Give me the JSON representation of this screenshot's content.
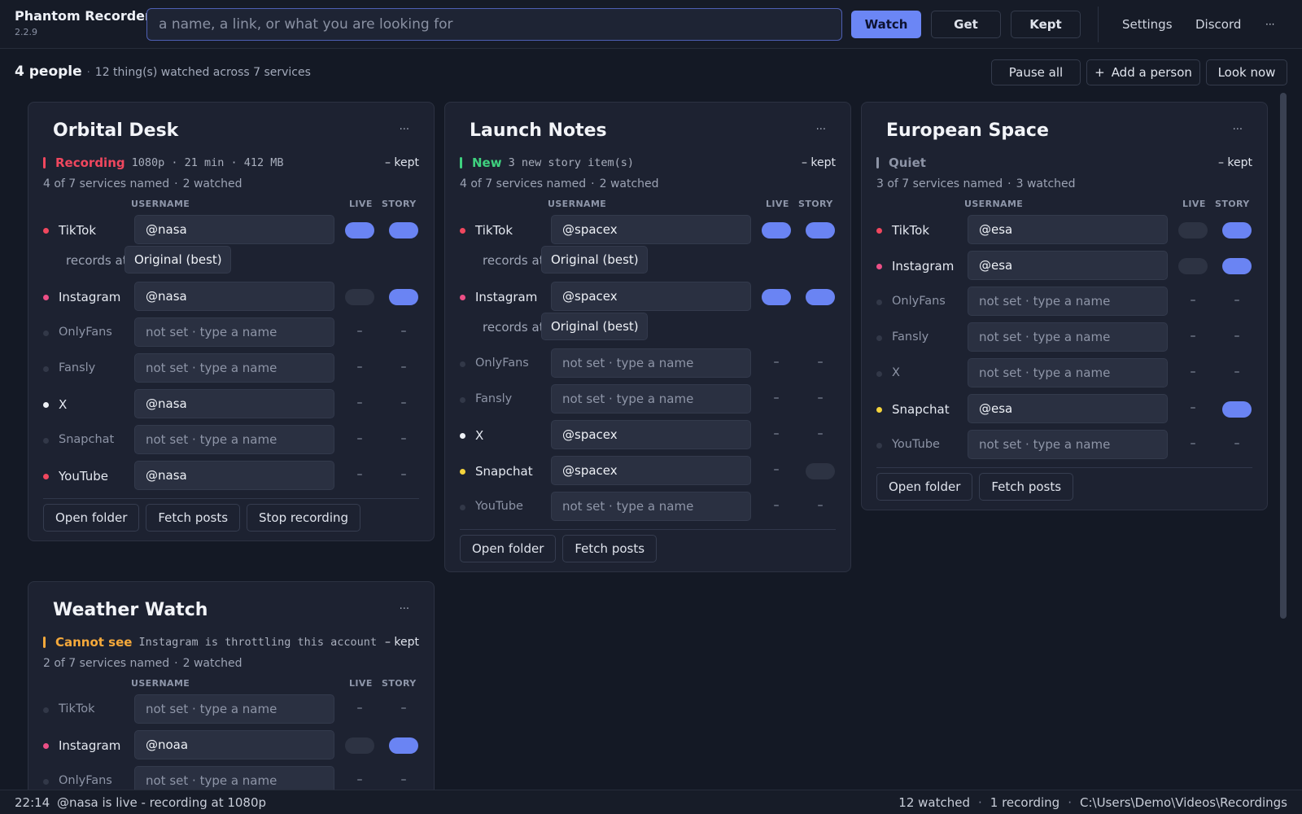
{
  "app": {
    "name": "Phantom Recorder",
    "version": "2.2.9"
  },
  "search": {
    "placeholder": "a name, a link, or what you are looking for"
  },
  "topbar": {
    "watch": "Watch",
    "get": "Get",
    "kept": "Kept",
    "settings": "Settings",
    "discord": "Discord",
    "more": "···"
  },
  "summary": {
    "people": "4 people",
    "detail": "12 thing(s) watched across 7 services"
  },
  "actions": {
    "pause_all": "Pause all",
    "add_person": "Add a person",
    "add_icon": "+",
    "look_now": "Look now"
  },
  "labels": {
    "username": "USERNAME",
    "live": "LIVE",
    "story": "STORY",
    "records_at": "records at",
    "kept": "– kept",
    "dash": "–",
    "menu": "···"
  },
  "colors": {
    "accent": "#6a84f3",
    "recording": "#f0475e",
    "new": "#3fd17f",
    "quiet": "#8c93a5",
    "cannot_see": "#f5a93b",
    "tiktok": "#f0475e",
    "instagram": "#ec4f86",
    "x": "#eef1f6",
    "snapchat": "#f4d33c",
    "youtube": "#f0475e",
    "unset": "#323848"
  },
  "cards": [
    {
      "title": "Orbital Desk",
      "status": {
        "label": "Recording",
        "detail": "1080p · 21 min · 412 MB",
        "color": "#f0475e"
      },
      "named": "4 of 7 services named",
      "watched": "2 watched",
      "services": [
        {
          "name": "TikTok",
          "set": true,
          "color": "#f0475e",
          "username": "@nasa",
          "live": "on",
          "story": "on",
          "records_at": "Original (best)"
        },
        {
          "name": "Instagram",
          "set": true,
          "color": "#ec4f86",
          "username": "@nasa",
          "live": "off",
          "story": "on"
        },
        {
          "name": "OnlyFans",
          "set": false,
          "username": "not set  ·  type a name",
          "live": "none",
          "story": "none"
        },
        {
          "name": "Fansly",
          "set": false,
          "username": "not set  ·  type a name",
          "live": "none",
          "story": "none"
        },
        {
          "name": "X",
          "set": true,
          "color": "#eef1f6",
          "username": "@nasa",
          "live": "none",
          "story": "none"
        },
        {
          "name": "Snapchat",
          "set": false,
          "username": "not set  ·  type a name",
          "live": "none",
          "story": "none"
        },
        {
          "name": "YouTube",
          "set": true,
          "color": "#f0475e",
          "username": "@nasa",
          "live": "none",
          "story": "none"
        }
      ],
      "buttons": [
        "Open folder",
        "Fetch posts",
        "Stop recording"
      ]
    },
    {
      "title": "Launch Notes",
      "status": {
        "label": "New",
        "detail": "3 new story item(s)",
        "color": "#3fd17f"
      },
      "named": "4 of 7 services named",
      "watched": "2 watched",
      "services": [
        {
          "name": "TikTok",
          "set": true,
          "color": "#f0475e",
          "username": "@spacex",
          "live": "on",
          "story": "on",
          "records_at": "Original (best)"
        },
        {
          "name": "Instagram",
          "set": true,
          "color": "#ec4f86",
          "username": "@spacex",
          "live": "on",
          "story": "on",
          "records_at": "Original (best)"
        },
        {
          "name": "OnlyFans",
          "set": false,
          "username": "not set  ·  type a name",
          "live": "none",
          "story": "none"
        },
        {
          "name": "Fansly",
          "set": false,
          "username": "not set  ·  type a name",
          "live": "none",
          "story": "none"
        },
        {
          "name": "X",
          "set": true,
          "color": "#eef1f6",
          "username": "@spacex",
          "live": "none",
          "story": "none"
        },
        {
          "name": "Snapchat",
          "set": true,
          "color": "#f4d33c",
          "username": "@spacex",
          "live": "none",
          "story": "off"
        },
        {
          "name": "YouTube",
          "set": false,
          "username": "not set  ·  type a name",
          "live": "none",
          "story": "none"
        }
      ],
      "buttons": [
        "Open folder",
        "Fetch posts"
      ]
    },
    {
      "title": "European Space",
      "status": {
        "label": "Quiet",
        "detail": "",
        "color": "#8c93a5"
      },
      "named": "3 of 7 services named",
      "watched": "3 watched",
      "services": [
        {
          "name": "TikTok",
          "set": true,
          "color": "#f0475e",
          "username": "@esa",
          "live": "off",
          "story": "on"
        },
        {
          "name": "Instagram",
          "set": true,
          "color": "#ec4f86",
          "username": "@esa",
          "live": "off",
          "story": "on"
        },
        {
          "name": "OnlyFans",
          "set": false,
          "username": "not set  ·  type a name",
          "live": "none",
          "story": "none"
        },
        {
          "name": "Fansly",
          "set": false,
          "username": "not set  ·  type a name",
          "live": "none",
          "story": "none"
        },
        {
          "name": "X",
          "set": false,
          "username": "not set  ·  type a name",
          "live": "none",
          "story": "none"
        },
        {
          "name": "Snapchat",
          "set": true,
          "color": "#f4d33c",
          "username": "@esa",
          "live": "none",
          "story": "on"
        },
        {
          "name": "YouTube",
          "set": false,
          "username": "not set  ·  type a name",
          "live": "none",
          "story": "none"
        }
      ],
      "buttons": [
        "Open folder",
        "Fetch posts"
      ]
    },
    {
      "title": "Weather Watch",
      "status": {
        "label": "Cannot see",
        "detail": "Instagram is throttling this account",
        "color": "#f5a93b"
      },
      "named": "2 of 7 services named",
      "watched": "2 watched",
      "services": [
        {
          "name": "TikTok",
          "set": false,
          "username": "not set  ·  type a name",
          "live": "none",
          "story": "none"
        },
        {
          "name": "Instagram",
          "set": true,
          "color": "#ec4f86",
          "username": "@noaa",
          "live": "off",
          "story": "on"
        },
        {
          "name": "OnlyFans",
          "set": false,
          "username": "not set  ·  type a name",
          "live": "none",
          "story": "none"
        }
      ],
      "buttons": []
    }
  ],
  "statusbar": {
    "time": "22:14",
    "message": "@nasa  is live - recording at 1080p",
    "watched": "12 watched",
    "recording": "1 recording",
    "path": "C:\\Users\\Demo\\Videos\\Recordings"
  }
}
